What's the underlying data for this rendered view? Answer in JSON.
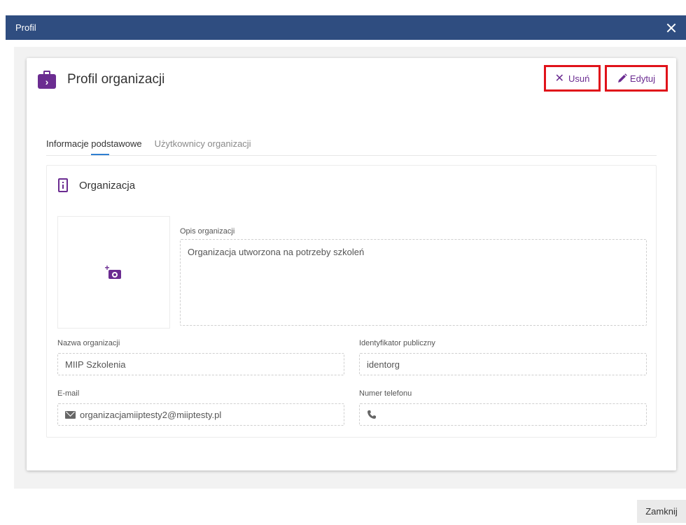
{
  "window": {
    "title": "Profil"
  },
  "card": {
    "title": "Profil organizacji",
    "delete_label": "Usuń",
    "edit_label": "Edytuj"
  },
  "tabs": [
    {
      "label": "Informacje podstawowe",
      "active": true
    },
    {
      "label": "Użytkownicy organizacji",
      "active": false
    }
  ],
  "section": {
    "title": "Organizacja"
  },
  "form": {
    "description_label": "Opis organizacji",
    "description_value": "Organizacja utworzona na potrzeby szkoleń",
    "name_label": "Nazwa organizacji",
    "name_value": "MIIP Szkolenia",
    "public_id_label": "Identyfikator publiczny",
    "public_id_value": "identorg",
    "email_label": "E-mail",
    "email_value": "organizacjamiiptesty2@miiptesty.pl",
    "phone_label": "Numer telefonu",
    "phone_value": ""
  },
  "footer": {
    "close_label": "Zamknij"
  },
  "colors": {
    "titlebar": "#2f4d80",
    "accent": "#6b2c91",
    "highlight": "#e0121a",
    "tab_underline": "#2f7fd1"
  }
}
